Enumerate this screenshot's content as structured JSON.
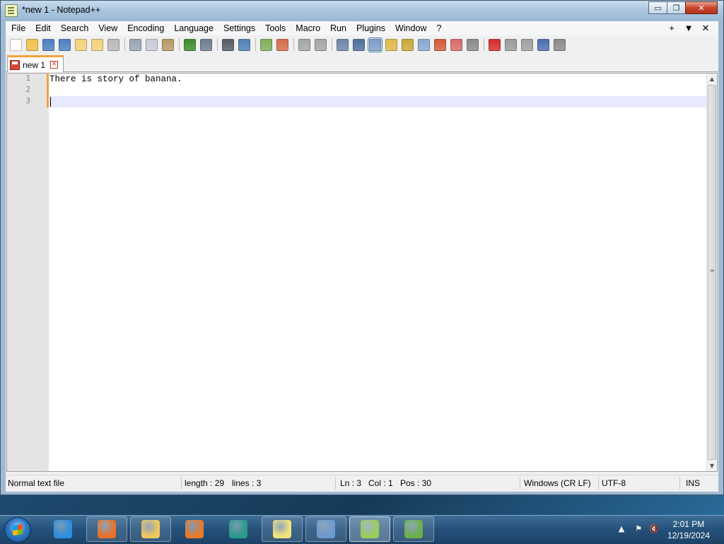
{
  "window": {
    "title": "*new 1 - Notepad++",
    "controls": {
      "minimize": "▭",
      "maximize": "❐",
      "close": "✕"
    }
  },
  "menu": {
    "items": [
      "File",
      "Edit",
      "Search",
      "View",
      "Encoding",
      "Language",
      "Settings",
      "Tools",
      "Macro",
      "Run",
      "Plugins",
      "Window",
      "?"
    ],
    "right": [
      "+",
      "▼",
      "✕"
    ]
  },
  "toolbar": {
    "icons": [
      {
        "name": "new-file-icon",
        "color": "#ffffff"
      },
      {
        "name": "open-file-icon",
        "color": "#f0c24a"
      },
      {
        "name": "save-icon",
        "color": "#4a7fc0"
      },
      {
        "name": "save-all-icon",
        "color": "#4a7fc0"
      },
      {
        "name": "close-icon",
        "color": "#f4d27a"
      },
      {
        "name": "close-all-icon",
        "color": "#f4d27a"
      },
      {
        "name": "print-icon",
        "color": "#b8b8b8"
      },
      {
        "sep": true
      },
      {
        "name": "cut-icon",
        "color": "#9aa4b3"
      },
      {
        "name": "copy-icon",
        "color": "#c7cdd8"
      },
      {
        "name": "paste-icon",
        "color": "#b59a62"
      },
      {
        "sep": true
      },
      {
        "name": "undo-icon",
        "color": "#3d8a2a"
      },
      {
        "name": "redo-icon",
        "color": "#6b7d8f"
      },
      {
        "sep": true
      },
      {
        "name": "find-icon",
        "color": "#555a66"
      },
      {
        "name": "replace-icon",
        "color": "#4d7fb8"
      },
      {
        "sep": true
      },
      {
        "name": "zoom-in-icon",
        "color": "#7fae5a"
      },
      {
        "name": "zoom-out-icon",
        "color": "#d46a4a"
      },
      {
        "sep": true
      },
      {
        "name": "sync-vertical-icon",
        "color": "#a5a5a5"
      },
      {
        "name": "sync-horizontal-icon",
        "color": "#a5a5a5"
      },
      {
        "sep": true
      },
      {
        "name": "word-wrap-icon",
        "color": "#6d86a8"
      },
      {
        "name": "show-all-chars-icon",
        "color": "#4d6f9a"
      },
      {
        "name": "indent-guide-icon",
        "color": "#7e9dc8",
        "active": true
      },
      {
        "name": "user-define-lang-icon",
        "color": "#e0b84a"
      },
      {
        "name": "doc-map-icon",
        "color": "#c9a832"
      },
      {
        "name": "function-list-icon",
        "color": "#8aa7cf"
      },
      {
        "name": "folder-as-workspace-icon",
        "color": "#d45a3a"
      },
      {
        "name": "monitoring-icon",
        "color": "#d86a6a"
      },
      {
        "name": "doc-list-icon",
        "color": "#8a8a8a"
      },
      {
        "sep": true
      },
      {
        "name": "record-macro-icon",
        "color": "#d42a2a"
      },
      {
        "name": "stop-record-icon",
        "color": "#9a9a9a"
      },
      {
        "name": "playback-macro-icon",
        "color": "#a0a0a0"
      },
      {
        "name": "run-macro-multiple-icon",
        "color": "#4a6fb0"
      },
      {
        "name": "save-macro-icon",
        "color": "#8a8a8a"
      }
    ]
  },
  "tab": {
    "label": "new 1",
    "close": "✕"
  },
  "editor": {
    "line_numbers": [
      "1",
      "2",
      "3"
    ],
    "lines": [
      "There is story of banana.",
      "",
      ""
    ],
    "current_line": 3
  },
  "status": {
    "file_type": "Normal text file",
    "length": "length : 29",
    "lines": "lines : 3",
    "ln": "Ln : 3",
    "col": "Col : 1",
    "pos": "Pos : 30",
    "eol": "Windows (CR LF)",
    "encoding": "UTF-8",
    "mode": "INS"
  },
  "taskbar": {
    "apps": [
      {
        "name": "internet-explorer-icon",
        "color": "#2d8fe0",
        "pinned": false
      },
      {
        "name": "firefox-icon",
        "color": "#e8712a",
        "pinned": true
      },
      {
        "name": "file-explorer-icon",
        "color": "#f0c75e",
        "pinned": true
      },
      {
        "name": "media-player-icon",
        "color": "#e87a2a",
        "pinned": false
      },
      {
        "name": "chat-app-icon",
        "color": "#2a9a8a",
        "pinned": false
      },
      {
        "name": "sticky-notes-icon",
        "color": "#f2e27a",
        "pinned": true
      },
      {
        "name": "control-panel-icon",
        "color": "#6a9ad0",
        "pinned": true
      },
      {
        "name": "notepad-plus-plus-icon",
        "color": "#9acd5a",
        "pinned": true,
        "active": true
      },
      {
        "name": "gecko-app-icon",
        "color": "#6ab04a",
        "pinned": true
      }
    ],
    "tray_icons": [
      "▲",
      "⚑",
      "🔇"
    ],
    "time": "2:01 PM",
    "date": "12/19/2024"
  }
}
